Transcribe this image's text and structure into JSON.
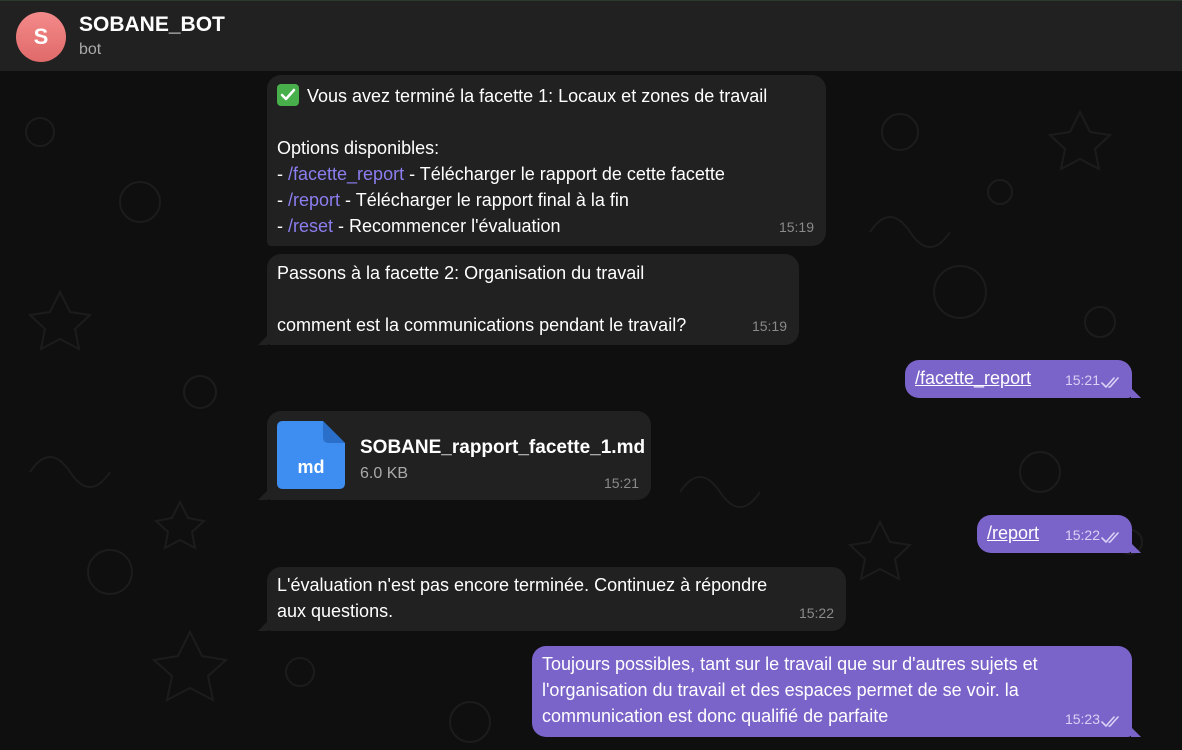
{
  "header": {
    "avatar_letter": "S",
    "title": "SOBANE_BOT",
    "subtitle": "bot"
  },
  "messages": {
    "m1": {
      "line1": "Vous avez terminé la facette 1: Locaux et zones de travail",
      "line2": "Options disponibles:",
      "opt1_prefix": "- ",
      "opt1_cmd": "/facette_report",
      "opt1_text": " - Télécharger le rapport de cette facette",
      "opt2_prefix": "- ",
      "opt2_cmd": "/report",
      "opt2_text": " - Télécharger le rapport final à la fin",
      "opt3_prefix": "- ",
      "opt3_cmd": "/reset",
      "opt3_text": " - Recommencer l'évaluation",
      "time": "15:19"
    },
    "m2": {
      "line1": "Passons à la facette 2: Organisation du travail",
      "line2": "comment est la communications pendant le travail?",
      "time": "15:19"
    },
    "m3": {
      "text": "/facette_report",
      "time": "15:21"
    },
    "m4": {
      "file_ext": "md",
      "file_name": "SOBANE_rapport_facette_1.md",
      "file_size": "6.0 KB",
      "time": "15:21"
    },
    "m5": {
      "text": "/report",
      "time": "15:22"
    },
    "m6": {
      "line1": "L'évaluation n'est pas encore terminée. Continuez à répondre",
      "line2": "aux questions.",
      "time": "15:22"
    },
    "m7": {
      "line1": "Toujours possibles, tant sur le travail que sur d'autres sujets et",
      "line2": "l'organisation du travail et des espaces permet de se voir. la",
      "line3": "communication est donc qualifié de parfaite",
      "time": "15:23"
    }
  },
  "colors": {
    "incoming_bubble": "#212121",
    "outgoing_bubble": "#7a63c9",
    "command_link": "#8b7ef0",
    "file_icon": "#3d8ef0",
    "header_bg": "#212121"
  }
}
